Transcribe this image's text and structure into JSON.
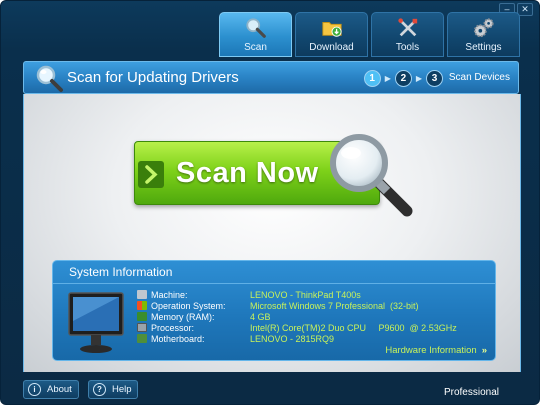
{
  "window": {
    "minimize_glyph": "–",
    "close_glyph": "✕"
  },
  "nav": {
    "tabs": [
      {
        "label": "Scan",
        "icon": "magnifier-icon",
        "active": true
      },
      {
        "label": "Download",
        "icon": "folder-download-icon"
      },
      {
        "label": "Tools",
        "icon": "tools-icon"
      },
      {
        "label": "Settings",
        "icon": "gears-icon"
      }
    ]
  },
  "header": {
    "title": "Scan for Updating Drivers",
    "steps": [
      "1",
      "2",
      "3"
    ],
    "active_step": 1,
    "step_label": "Scan Devices"
  },
  "main": {
    "scan_button_label": "Scan Now"
  },
  "system_info": {
    "title": "System Information",
    "rows": [
      {
        "label": "Machine:",
        "value": "LENOVO - ThinkPad T400s",
        "icon": "machine-icon"
      },
      {
        "label": "Operation System:",
        "value": "Microsoft Windows 7 Professional  (32-bit)",
        "icon": "windows-icon"
      },
      {
        "label": "Memory (RAM):",
        "value": "4 GB",
        "icon": "memory-icon"
      },
      {
        "label": "Processor:",
        "value": "Intel(R) Core(TM)2 Duo CPU     P9600  @ 2.53GHz",
        "icon": "processor-icon"
      },
      {
        "label": "Motherboard:",
        "value": "LENOVO - 2815RQ9",
        "icon": "motherboard-icon"
      }
    ],
    "link_label": "Hardware Information",
    "link_glyph": "»"
  },
  "footer": {
    "about_label": "About",
    "about_glyph": "i",
    "help_label": "Help",
    "help_glyph": "?",
    "edition": "Professional"
  },
  "colors": {
    "accent_green": "#7fd21a",
    "value_green": "#c8f25a",
    "panel_blue": "#1f78bc"
  }
}
